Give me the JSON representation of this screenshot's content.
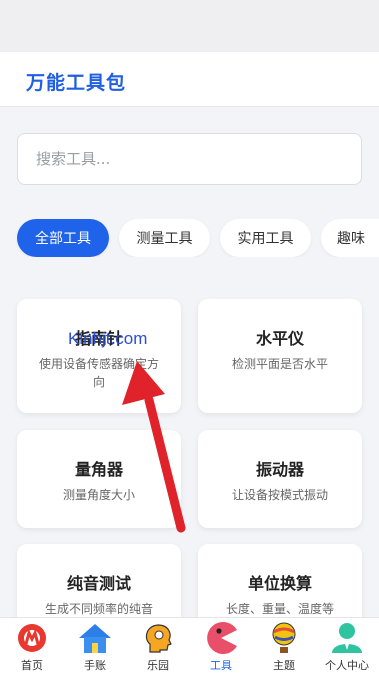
{
  "header": {
    "title": "万能工具包"
  },
  "search": {
    "placeholder": "搜索工具..."
  },
  "tabs": [
    {
      "label": "全部工具",
      "active": true
    },
    {
      "label": "测量工具",
      "active": false
    },
    {
      "label": "实用工具",
      "active": false
    },
    {
      "label": "趣味",
      "active": false
    }
  ],
  "tools": [
    {
      "title": "指南针",
      "desc": "使用设备传感器确定方向"
    },
    {
      "title": "水平仪",
      "desc": "检测平面是否水平"
    },
    {
      "title": "量角器",
      "desc": "测量角度大小"
    },
    {
      "title": "振动器",
      "desc": "让设备按模式振动"
    },
    {
      "title": "纯音测试",
      "desc": "生成不同频率的纯音"
    },
    {
      "title": "单位换算",
      "desc": "长度、重量、温度等"
    }
  ],
  "watermark": "Kinhjt.com",
  "bottom_nav": [
    {
      "label": "首页",
      "icon": "metro-logo-icon"
    },
    {
      "label": "手账",
      "icon": "house-icon"
    },
    {
      "label": "乐园",
      "icon": "head-profile-icon"
    },
    {
      "label": "工具",
      "icon": "pacman-icon",
      "active": true
    },
    {
      "label": "主题",
      "icon": "hot-air-balloon-icon"
    },
    {
      "label": "个人中心",
      "icon": "person-icon"
    }
  ],
  "colors": {
    "accent": "#1f63ea",
    "title_blue": "#1f5fe0",
    "arrow": "#e0222b"
  }
}
